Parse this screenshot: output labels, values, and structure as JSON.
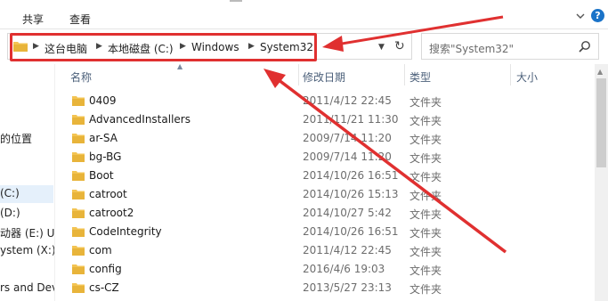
{
  "ribbon": {
    "tab_share": "共享",
    "tab_view": "查看"
  },
  "address": {
    "crumbs": [
      "这台电脑",
      "本地磁盘 (C:)",
      "Windows",
      "System32"
    ]
  },
  "search": {
    "placeholder": "搜索\"System32\""
  },
  "nav": {
    "items": [
      "的位置",
      "(C:)",
      "(D:)",
      "动器 (E:) U盘",
      "ystem (X:)",
      "rs and Dev"
    ]
  },
  "columns": {
    "name": "名称",
    "date": "修改日期",
    "type": "类型",
    "size": "大小"
  },
  "files": [
    {
      "name": "0409",
      "date": "2011/4/12 22:45",
      "type": "文件夹"
    },
    {
      "name": "AdvancedInstallers",
      "date": "2011/11/21 11:30",
      "type": "文件夹"
    },
    {
      "name": "ar-SA",
      "date": "2009/7/14 11:20",
      "type": "文件夹"
    },
    {
      "name": "bg-BG",
      "date": "2009/7/14 11:20",
      "type": "文件夹"
    },
    {
      "name": "Boot",
      "date": "2014/10/26 16:51",
      "type": "文件夹"
    },
    {
      "name": "catroot",
      "date": "2014/10/26 15:13",
      "type": "文件夹"
    },
    {
      "name": "catroot2",
      "date": "2014/10/27 5:42",
      "type": "文件夹"
    },
    {
      "name": "CodeIntegrity",
      "date": "2014/10/26 16:51",
      "type": "文件夹"
    },
    {
      "name": "com",
      "date": "2011/4/12 22:45",
      "type": "文件夹"
    },
    {
      "name": "config",
      "date": "2016/4/6 19:03",
      "type": "文件夹"
    },
    {
      "name": "cs-CZ",
      "date": "2013/5/27 23:13",
      "type": "文件夹"
    }
  ],
  "colors": {
    "highlight": "#e03030",
    "folder": "#f3c453",
    "header_text": "#4c607a"
  }
}
